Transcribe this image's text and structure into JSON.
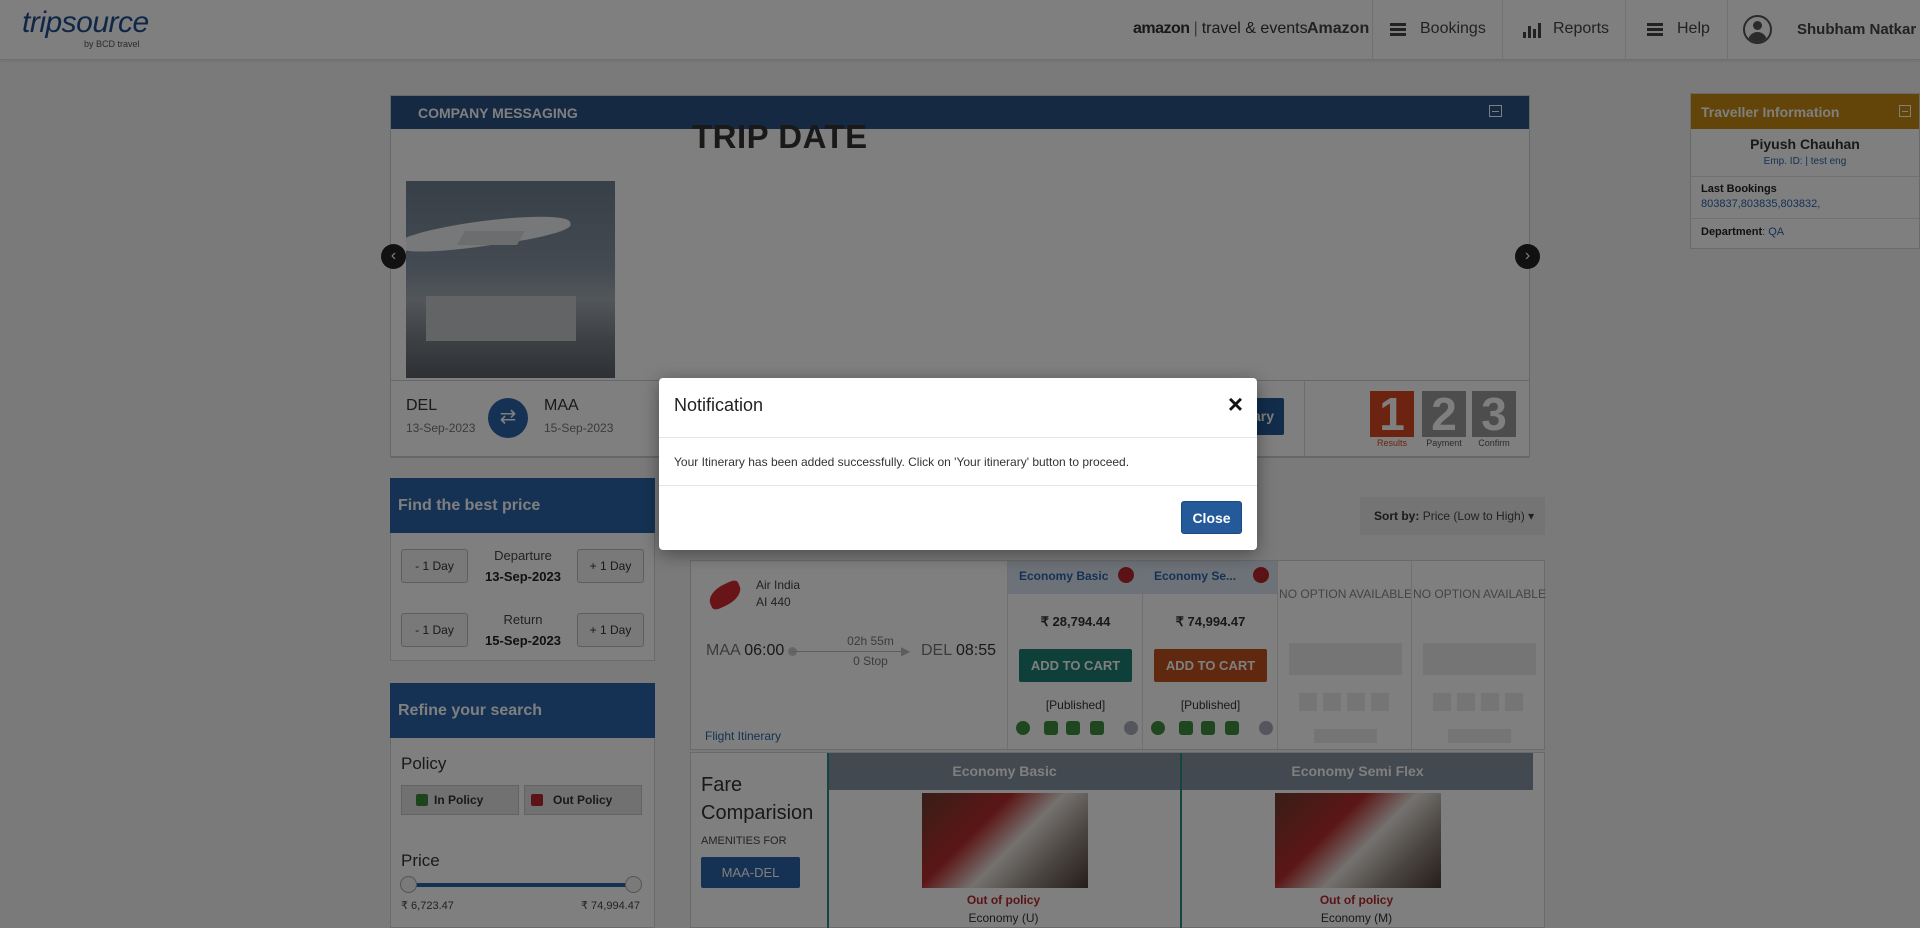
{
  "header": {
    "logo_text": "tripsource",
    "logo_sub": "by BCD travel",
    "brand_left": "amazon",
    "brand_right": "travel & events",
    "company": "Amazon",
    "nav": [
      {
        "label": "Bookings",
        "icon": "menu-icon"
      },
      {
        "label": "Reports",
        "icon": "bar-chart-icon"
      },
      {
        "label": "Help",
        "icon": "menu-icon"
      }
    ],
    "user_name": "Shubham Natkar"
  },
  "company_messaging": {
    "title": "COMPANY MESSAGING",
    "slide_heading": "TRIP DATE",
    "prev_icon": "‹",
    "next_icon": "›"
  },
  "search_summary": {
    "origin": "DEL",
    "origin_date": "13-Sep-2023",
    "destination": "MAA",
    "destination_date": "15-Sep-2023",
    "itinerary_button": "rary",
    "steps": [
      {
        "num": "1",
        "label": "Results",
        "color": "#d8471f"
      },
      {
        "num": "2",
        "label": "Payment",
        "color": "#9a9a9a"
      },
      {
        "num": "3",
        "label": "Confirm",
        "color": "#9a9a9a"
      }
    ]
  },
  "find_best_price": {
    "title": "Find the best price",
    "minus_label": "- 1 Day",
    "plus_label": "+ 1 Day",
    "departure_label": "Departure",
    "departure_date": "13-Sep-2023",
    "return_label": "Return",
    "return_date": "15-Sep-2023"
  },
  "refine": {
    "title": "Refine your search",
    "policy_title": "Policy",
    "in_policy": "In Policy",
    "out_policy": "Out Policy",
    "price_title": "Price",
    "price_min": "₹ 6,723.47",
    "price_max": "₹ 74,994.47"
  },
  "sort": {
    "label": "Sort by:",
    "value": "Price (Low to High)"
  },
  "result": {
    "airline": "Air India",
    "flight_no": "AI  440",
    "from_code": "MAA",
    "dep_time": "06:00",
    "duration": "02h 55m",
    "stops": "0 Stop",
    "to_code": "DEL",
    "arr_time": "08:55",
    "flight_itinerary_link": "Flight Itinerary",
    "fares": [
      {
        "name": "Economy Basic",
        "price": "₹ 28,794.44",
        "button": "ADD TO CART",
        "button_color": "#1f7f72",
        "fare_type": "[Published]"
      },
      {
        "name": "Economy Se...",
        "price": "₹ 74,994.47",
        "button": "ADD TO CART",
        "button_color": "#c1511c",
        "fare_type": "[Published]"
      }
    ],
    "no_option": "NO OPTION AVAILABLE"
  },
  "fare_comparison": {
    "title": "Fare Comparision",
    "amenities_for": "AMENITIES FOR",
    "route": "MAA-DEL",
    "columns": [
      {
        "name": "Economy Basic",
        "policy": "Out of policy",
        "class": "Economy (U)"
      },
      {
        "name": "Economy Semi Flex",
        "policy": "Out of policy",
        "class": "Economy (M)"
      }
    ]
  },
  "traveller": {
    "title": "Traveller Information",
    "name": "Piyush Chauhan",
    "emp_id": "Emp. ID: | test eng",
    "last_bookings_label": "Last Bookings",
    "last_bookings": "803837,803835,803832,",
    "department_label": "Department",
    "department": ": QA"
  },
  "modal": {
    "title": "Notification",
    "close_x": "×",
    "message": "Your Itinerary has been added successfully. Click on 'Your itinerary' button to proceed.",
    "close_button": "Close"
  }
}
